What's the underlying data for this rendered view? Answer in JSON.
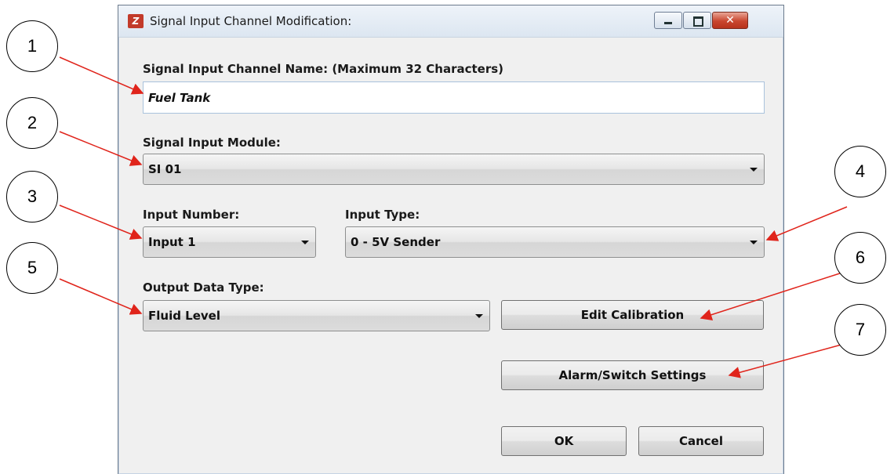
{
  "window": {
    "title": "Signal Input Channel Modification:",
    "icon": "app-logo-icon",
    "controls": {
      "minimize": "minimize-icon",
      "maximize": "maximize-icon",
      "close": "close-icon"
    }
  },
  "form": {
    "name_label": "Signal Input Channel Name: (Maximum 32 Characters)",
    "name_value": "Fuel Tank",
    "module_label": "Signal Input Module:",
    "module_value": "SI 01",
    "input_number_label": "Input Number:",
    "input_number_value": "Input 1",
    "input_type_label": "Input Type:",
    "input_type_value": "0 - 5V Sender",
    "output_type_label": "Output Data Type:",
    "output_type_value": "Fluid Level"
  },
  "buttons": {
    "edit_calibration": "Edit Calibration",
    "alarm_switch": "Alarm/Switch Settings",
    "ok": "OK",
    "cancel": "Cancel"
  },
  "callouts": [
    "1",
    "2",
    "3",
    "4",
    "5",
    "6",
    "7"
  ],
  "colors": {
    "arrow": "#e0241b",
    "close_button": "#c9462f"
  }
}
